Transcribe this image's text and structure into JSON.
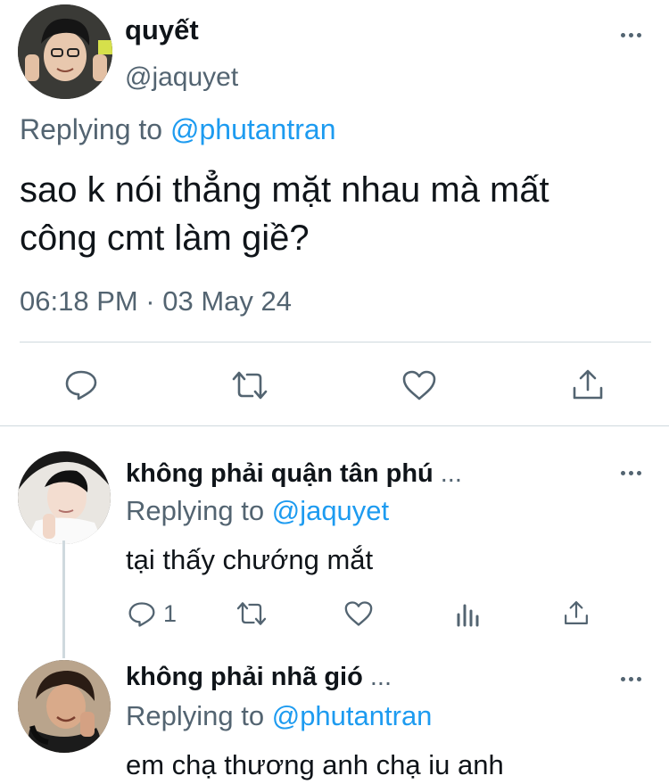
{
  "main_tweet": {
    "author_name": "quyết",
    "handle": "@jaquyet",
    "replying_prefix": "Replying to",
    "replying_mention": "@phutantran",
    "text_line1": "sao k nói thẳng mặt nhau mà mất",
    "text_line2": "công cmt làm giề?",
    "timestamp": "06:18 PM · 03 May 24",
    "actions": [
      "reply-icon",
      "retweet-icon",
      "like-icon",
      "share-icon"
    ]
  },
  "replies": [
    {
      "author_name": "không phải quận tân phú",
      "ellipsis": "...",
      "replying_prefix": "Replying to",
      "replying_mention": "@jaquyet",
      "text": "tại thấy chướng mắt",
      "reply_count": "1",
      "actions": [
        "reply-icon",
        "retweet-icon",
        "like-icon",
        "analytics-icon",
        "share-icon"
      ]
    },
    {
      "author_name": "không phải nhã gió",
      "ellipsis": "...",
      "replying_prefix": "Replying to",
      "replying_mention": "@phutantran",
      "text": "em chạ thương anh chạ iu anh"
    }
  ],
  "colors": {
    "text": "#0f1419",
    "secondary": "#536471",
    "link": "#1d9bf0",
    "divider": "#cfd9de"
  }
}
